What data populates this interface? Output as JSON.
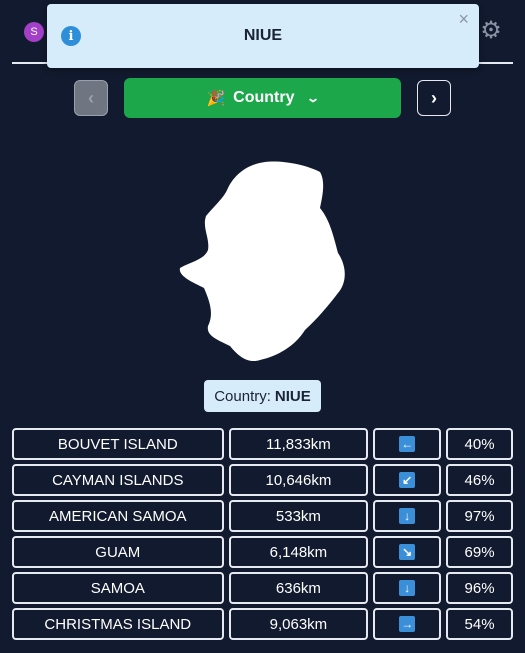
{
  "header": {
    "avatar_letter": "S",
    "settings_icon": "gear-icon"
  },
  "toast": {
    "title": "NIUE",
    "close_label": "×",
    "icon": "info-icon"
  },
  "nav": {
    "prev_label": "‹",
    "next_label": "›",
    "mode_icon": "🎉",
    "mode_label": "Country",
    "mode_chevron": "⌄"
  },
  "answer": {
    "prefix": "Country:",
    "name": "NIUE"
  },
  "guesses": [
    {
      "name": "BOUVET ISLAND",
      "distance": "11,833km",
      "direction": "←",
      "direction_icon": "arrow-left-icon",
      "proximity": "40%"
    },
    {
      "name": "CAYMAN ISLANDS",
      "distance": "10,646km",
      "direction": "↙",
      "direction_icon": "arrow-down-left-icon",
      "proximity": "46%"
    },
    {
      "name": "AMERICAN SAMOA",
      "distance": "533km",
      "direction": "↓",
      "direction_icon": "arrow-down-icon",
      "proximity": "97%"
    },
    {
      "name": "GUAM",
      "distance": "6,148km",
      "direction": "↘",
      "direction_icon": "arrow-down-right-icon",
      "proximity": "69%"
    },
    {
      "name": "SAMOA",
      "distance": "636km",
      "direction": "↓",
      "direction_icon": "arrow-down-icon",
      "proximity": "96%"
    },
    {
      "name": "CHRISTMAS ISLAND",
      "distance": "9,063km",
      "direction": "→",
      "direction_icon": "arrow-right-icon",
      "proximity": "54%"
    }
  ],
  "colors": {
    "background": "#111a2e",
    "accent_green": "#1ca74b",
    "toast_bg": "#d7ecfb",
    "arrow_blue": "#3b8fd9"
  }
}
